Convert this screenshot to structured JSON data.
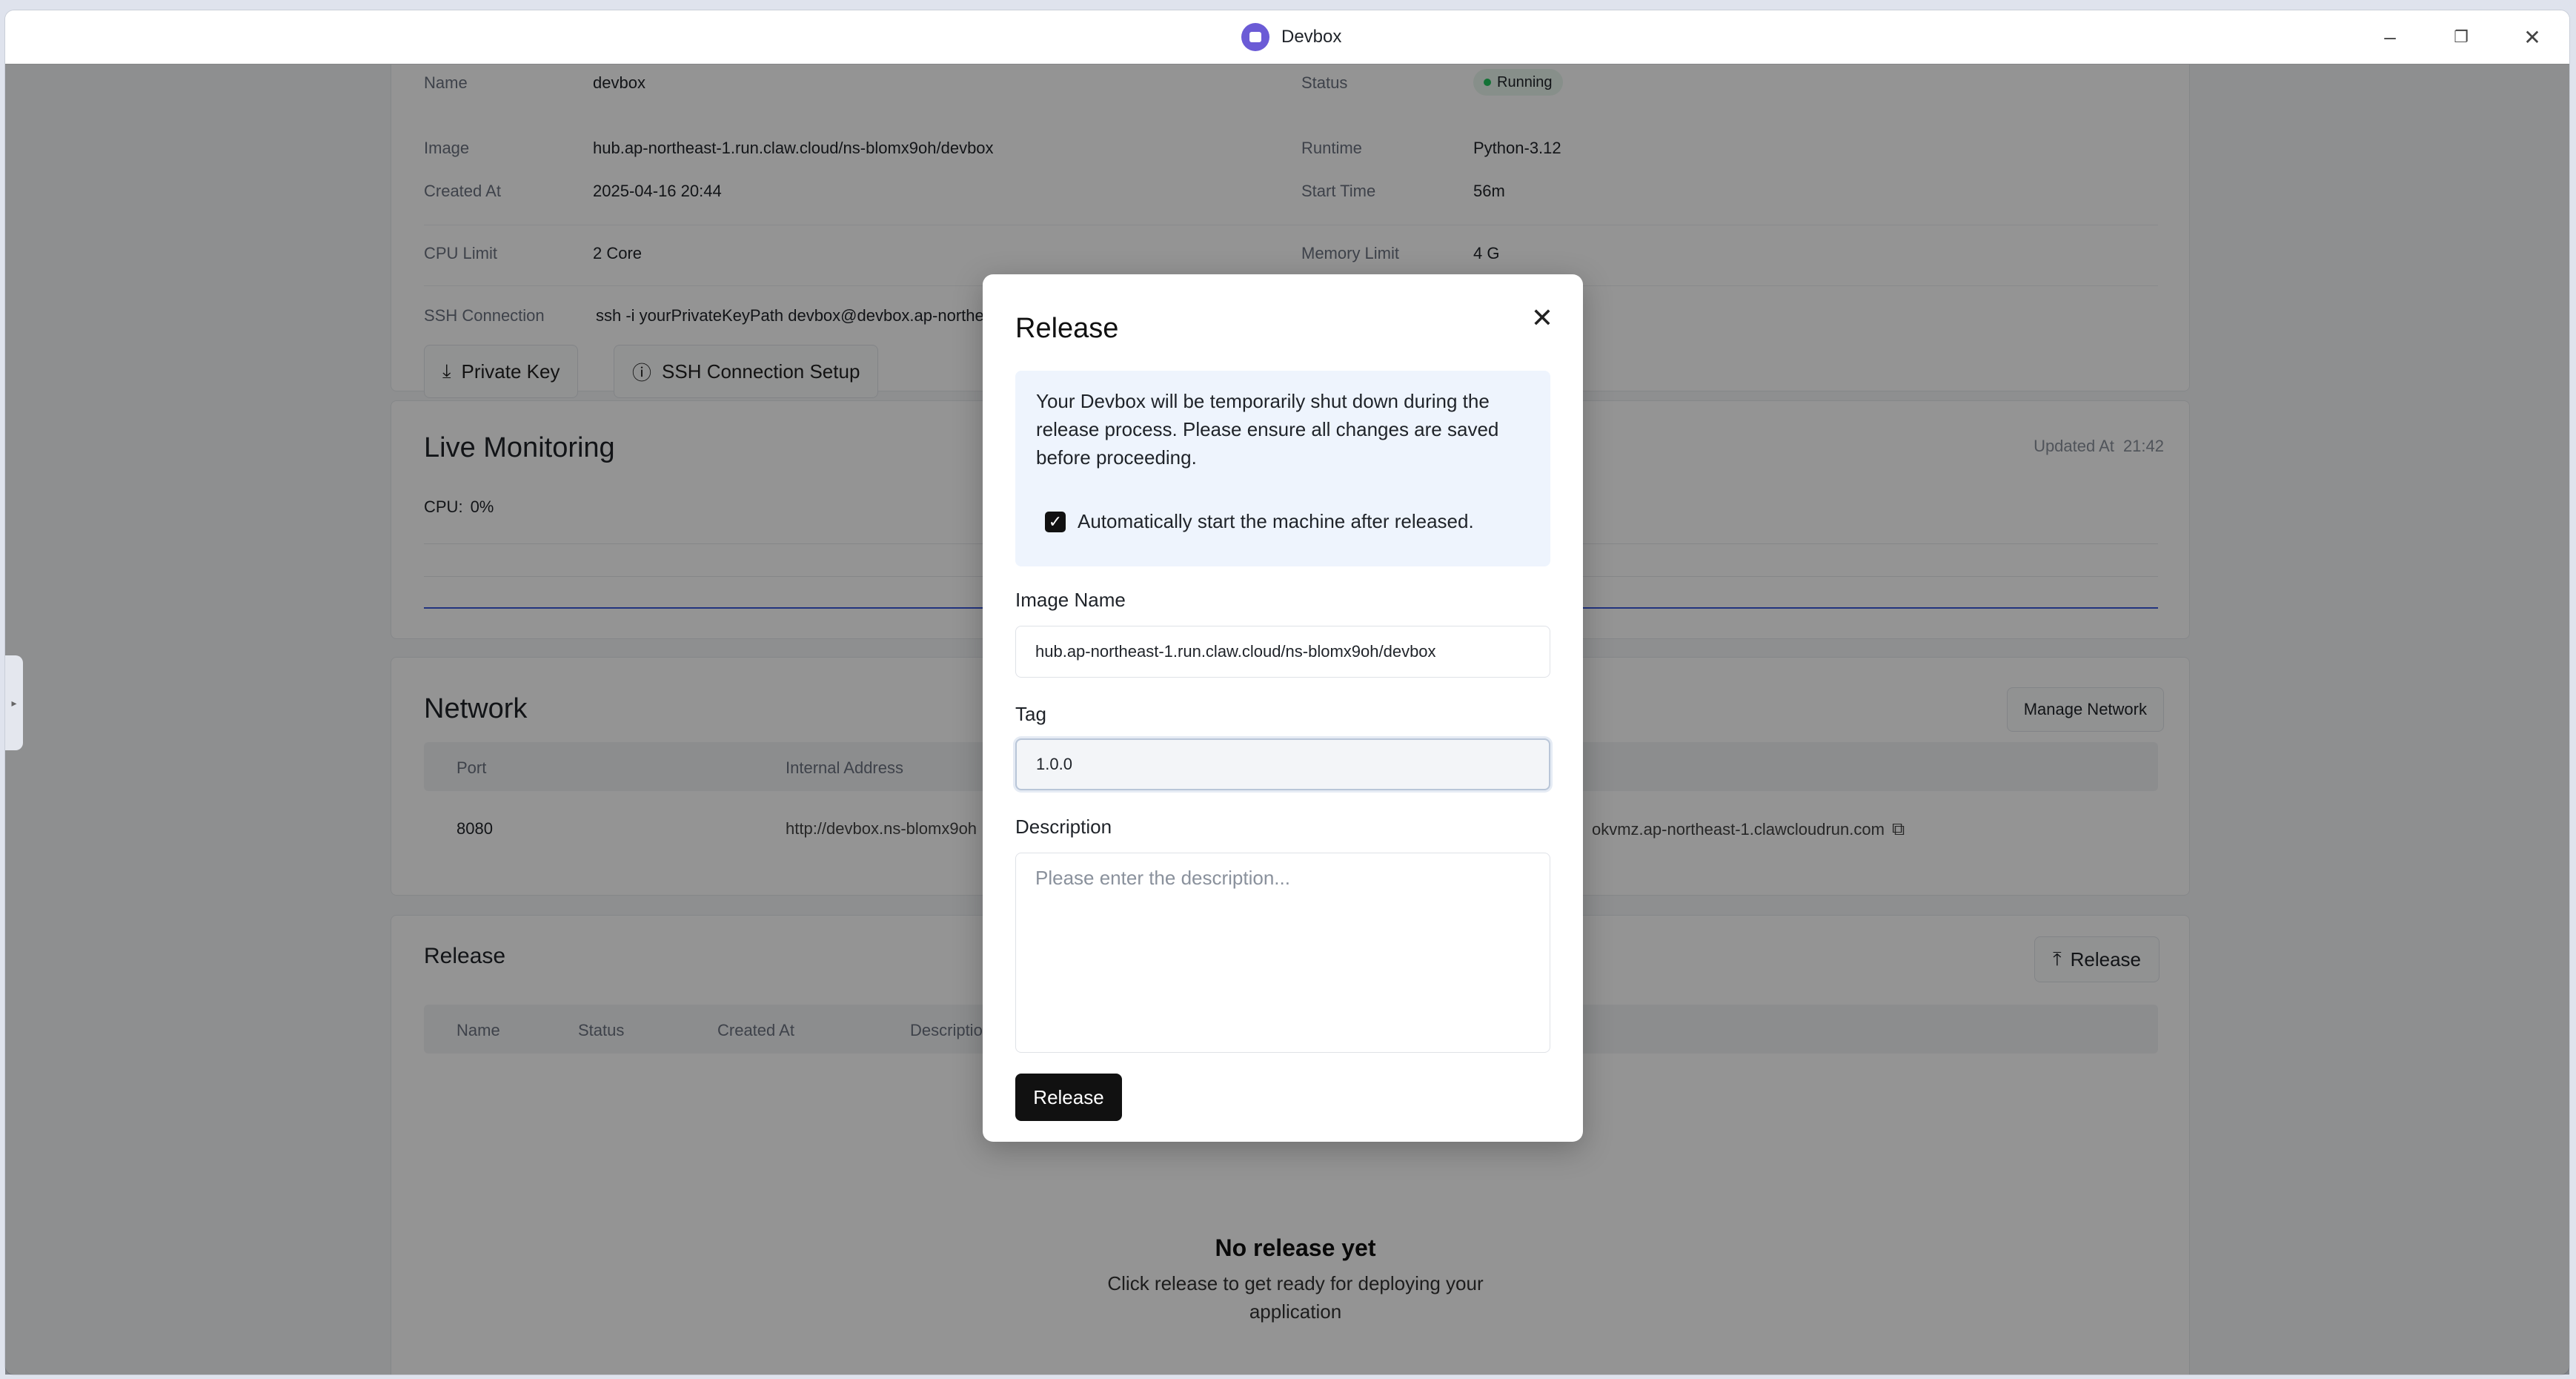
{
  "window": {
    "title": "Devbox"
  },
  "details": {
    "name_label": "Name",
    "name_value": "devbox",
    "status_label": "Status",
    "status_value": "Running",
    "image_label": "Image",
    "image_value": "hub.ap-northeast-1.run.claw.cloud/ns-blomx9oh/devbox",
    "runtime_label": "Runtime",
    "runtime_value": "Python-3.12",
    "created_label": "Created At",
    "created_value": "2025-04-16 20:44",
    "start_label": "Start Time",
    "start_value": "56m",
    "cpu_label": "CPU Limit",
    "cpu_value": "2 Core",
    "memory_label": "Memory Limit",
    "memory_value": "4 G",
    "ssh_label": "SSH Connection",
    "ssh_value": "ssh -i yourPrivateKeyPath devbox@devbox.ap-northeast-1.clawcloudrun.com -p 31771",
    "private_key_button": "Private Key",
    "ssh_setup_button": "SSH Connection Setup"
  },
  "monitoring": {
    "title": "Live Monitoring",
    "updated_label": "Updated At",
    "updated_value": "21:42",
    "cpu_label": "CPU:",
    "cpu_value": "0%"
  },
  "network": {
    "title": "Network",
    "manage_button": "Manage Network",
    "col_port": "Port",
    "col_internal": "Internal Address",
    "row_port": "8080",
    "row_internal": "http://devbox.ns-blomx9oh",
    "row_public": "okvmz.ap-northeast-1.clawcloudrun.com"
  },
  "release_section": {
    "title": "Release",
    "release_button": "Release",
    "col_name": "Name",
    "col_status": "Status",
    "col_created": "Created At",
    "col_description": "Description",
    "empty_title": "No release yet",
    "empty_text": "Click release to get ready for deploying your application"
  },
  "modal": {
    "title": "Release",
    "info_text": "Your Devbox will be temporarily shut down during the release process. Please ensure all changes are saved before proceeding.",
    "auto_start_label": "Automatically start the machine after released.",
    "auto_start_checked": true,
    "image_name_label": "Image Name",
    "image_name_value": "hub.ap-northeast-1.run.claw.cloud/ns-blomx9oh/devbox",
    "tag_label": "Tag",
    "tag_value": "1.0.0",
    "description_label": "Description",
    "description_placeholder": "Please enter the  description...",
    "submit_button": "Release"
  },
  "colors": {
    "accent": "#111111",
    "info_bg": "#eef4fd",
    "status_green": "#22c55e",
    "app_icon": "#6b5bd6"
  }
}
